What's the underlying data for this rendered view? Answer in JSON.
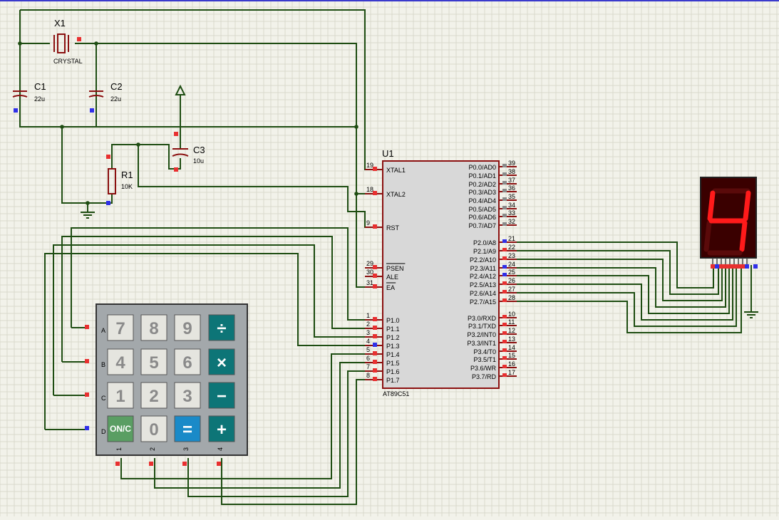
{
  "colors": {
    "background": "#f2f2ea",
    "grid": "#d9d9cc",
    "wire": "#1e4d12",
    "outline": "#8b1010",
    "pin_marker": "#e83030",
    "pin_marker_input": "#3030e8",
    "chip_fill": "#d8d8d8",
    "keypad_body": "#a3a8ab",
    "key_gray": "#e5e5df",
    "key_teal": "#0d7577",
    "key_blue": "#1a8ac8",
    "key_green": "#5a9e63",
    "segment_on": "#ff1a1a",
    "segment_off": "#5a0a0a",
    "display_body": "#3a0000"
  },
  "components": {
    "crystal": {
      "ref": "X1",
      "value": "CRYSTAL"
    },
    "c1": {
      "ref": "C1",
      "value": "22u"
    },
    "c2": {
      "ref": "C2",
      "value": "22u"
    },
    "c3": {
      "ref": "C3",
      "value": "10u"
    },
    "r1": {
      "ref": "R1",
      "value": "10K"
    }
  },
  "mcu": {
    "ref": "U1",
    "part": "AT89C51",
    "left_pins": [
      {
        "num": "19",
        "name": "XTAL1"
      },
      {
        "num": "18",
        "name": "XTAL2"
      },
      {
        "num": "9",
        "name": "RST"
      },
      {
        "num": "29",
        "name": "PSEN"
      },
      {
        "num": "30",
        "name": "ALE"
      },
      {
        "num": "31",
        "name": "EA"
      },
      {
        "num": "1",
        "name": "P1.0"
      },
      {
        "num": "2",
        "name": "P1.1"
      },
      {
        "num": "3",
        "name": "P1.2"
      },
      {
        "num": "4",
        "name": "P1.3"
      },
      {
        "num": "5",
        "name": "P1.4"
      },
      {
        "num": "6",
        "name": "P1.5"
      },
      {
        "num": "7",
        "name": "P1.6"
      },
      {
        "num": "8",
        "name": "P1.7"
      }
    ],
    "right_pins": [
      {
        "num": "39",
        "name": "P0.0/AD0"
      },
      {
        "num": "38",
        "name": "P0.1/AD1"
      },
      {
        "num": "37",
        "name": "P0.2/AD2"
      },
      {
        "num": "36",
        "name": "P0.3/AD3"
      },
      {
        "num": "35",
        "name": "P0.4/AD4"
      },
      {
        "num": "34",
        "name": "P0.5/AD5"
      },
      {
        "num": "33",
        "name": "P0.6/AD6"
      },
      {
        "num": "32",
        "name": "P0.7/AD7"
      },
      {
        "num": "21",
        "name": "P2.0/A8"
      },
      {
        "num": "22",
        "name": "P2.1/A9"
      },
      {
        "num": "23",
        "name": "P2.2/A10"
      },
      {
        "num": "24",
        "name": "P2.3/A11"
      },
      {
        "num": "25",
        "name": "P2.4/A12"
      },
      {
        "num": "26",
        "name": "P2.5/A13"
      },
      {
        "num": "27",
        "name": "P2.6/A14"
      },
      {
        "num": "28",
        "name": "P2.7/A15"
      },
      {
        "num": "10",
        "name": "P3.0/RXD"
      },
      {
        "num": "11",
        "name": "P3.1/TXD"
      },
      {
        "num": "12",
        "name": "P3.2/INT0"
      },
      {
        "num": "13",
        "name": "P3.3/INT1"
      },
      {
        "num": "14",
        "name": "P3.4/T0"
      },
      {
        "num": "15",
        "name": "P3.5/T1"
      },
      {
        "num": "16",
        "name": "P3.6/WR"
      },
      {
        "num": "17",
        "name": "P3.7/RD"
      }
    ]
  },
  "keypad": {
    "row_labels": [
      "A",
      "B",
      "C",
      "D"
    ],
    "col_labels": [
      "1",
      "2",
      "3",
      "4"
    ],
    "keys": [
      [
        "7",
        "8",
        "9",
        "÷"
      ],
      [
        "4",
        "5",
        "6",
        "×"
      ],
      [
        "1",
        "2",
        "3",
        "−"
      ],
      [
        "ON/C",
        "0",
        "=",
        "+"
      ]
    ]
  },
  "display": {
    "digit": "4"
  }
}
